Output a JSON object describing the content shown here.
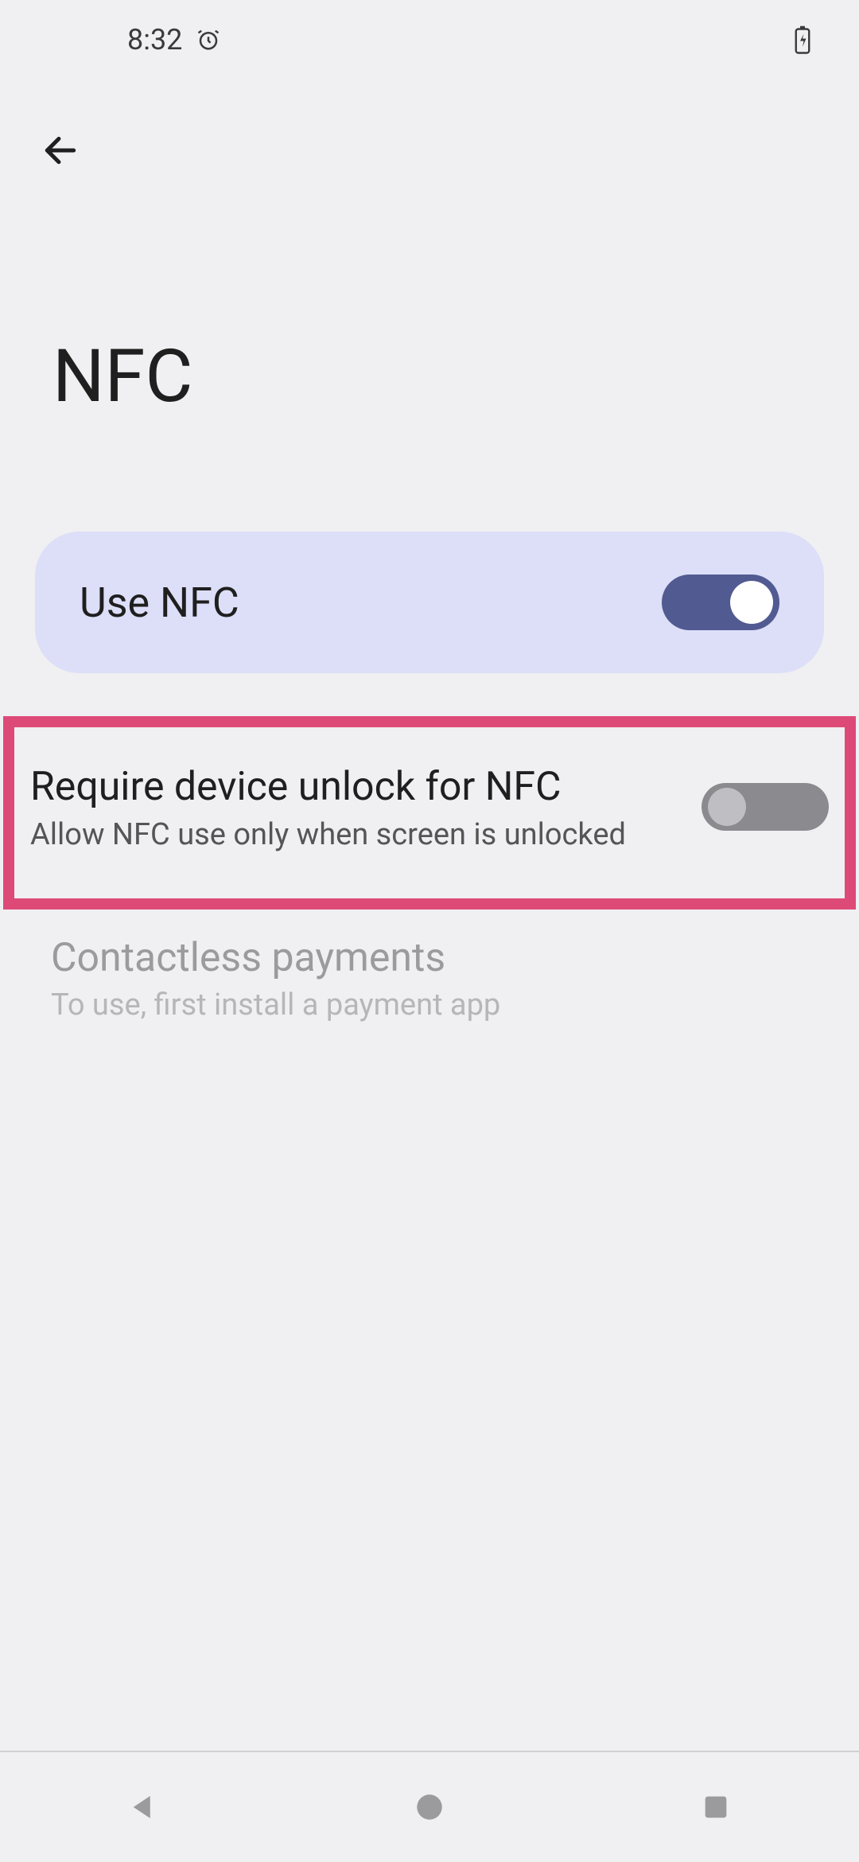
{
  "statusbar": {
    "time": "8:32"
  },
  "header": {
    "title": "NFC"
  },
  "settings": {
    "use_nfc": {
      "label": "Use NFC",
      "enabled": true
    },
    "require_unlock": {
      "label": "Require device unlock for NFC",
      "subtitle": "Allow NFC use only when screen is unlocked",
      "enabled": false
    },
    "contactless": {
      "label": "Contactless payments",
      "subtitle": "To use, first install a payment app",
      "available": false
    }
  },
  "colors": {
    "accent": "#525a92",
    "card": "#dcdff7",
    "highlight_border": "#dd4a78"
  }
}
